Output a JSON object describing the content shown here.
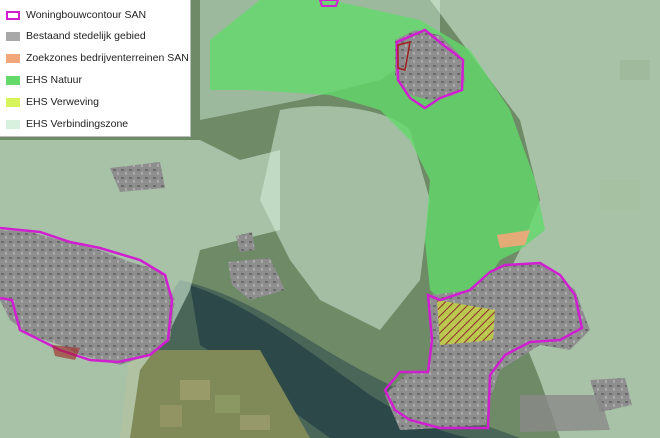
{
  "legend": {
    "items": [
      {
        "label": "Woningbouwcontour SAN",
        "color": "#d01fd0",
        "style": "outline"
      },
      {
        "label": "Bestaand stedelijk gebied",
        "color": "#a8a8a8",
        "style": "fill"
      },
      {
        "label": "Zoekzones bedrijventerreinen SAN",
        "color": "#f2a77a",
        "style": "fill"
      },
      {
        "label": "EHS Natuur",
        "color": "#62d96a",
        "style": "fill"
      },
      {
        "label": "EHS Verweving",
        "color": "#d7f55a",
        "style": "fill"
      },
      {
        "label": "EHS Verbindingszone",
        "color": "#d8f1df",
        "style": "fill"
      }
    ]
  }
}
